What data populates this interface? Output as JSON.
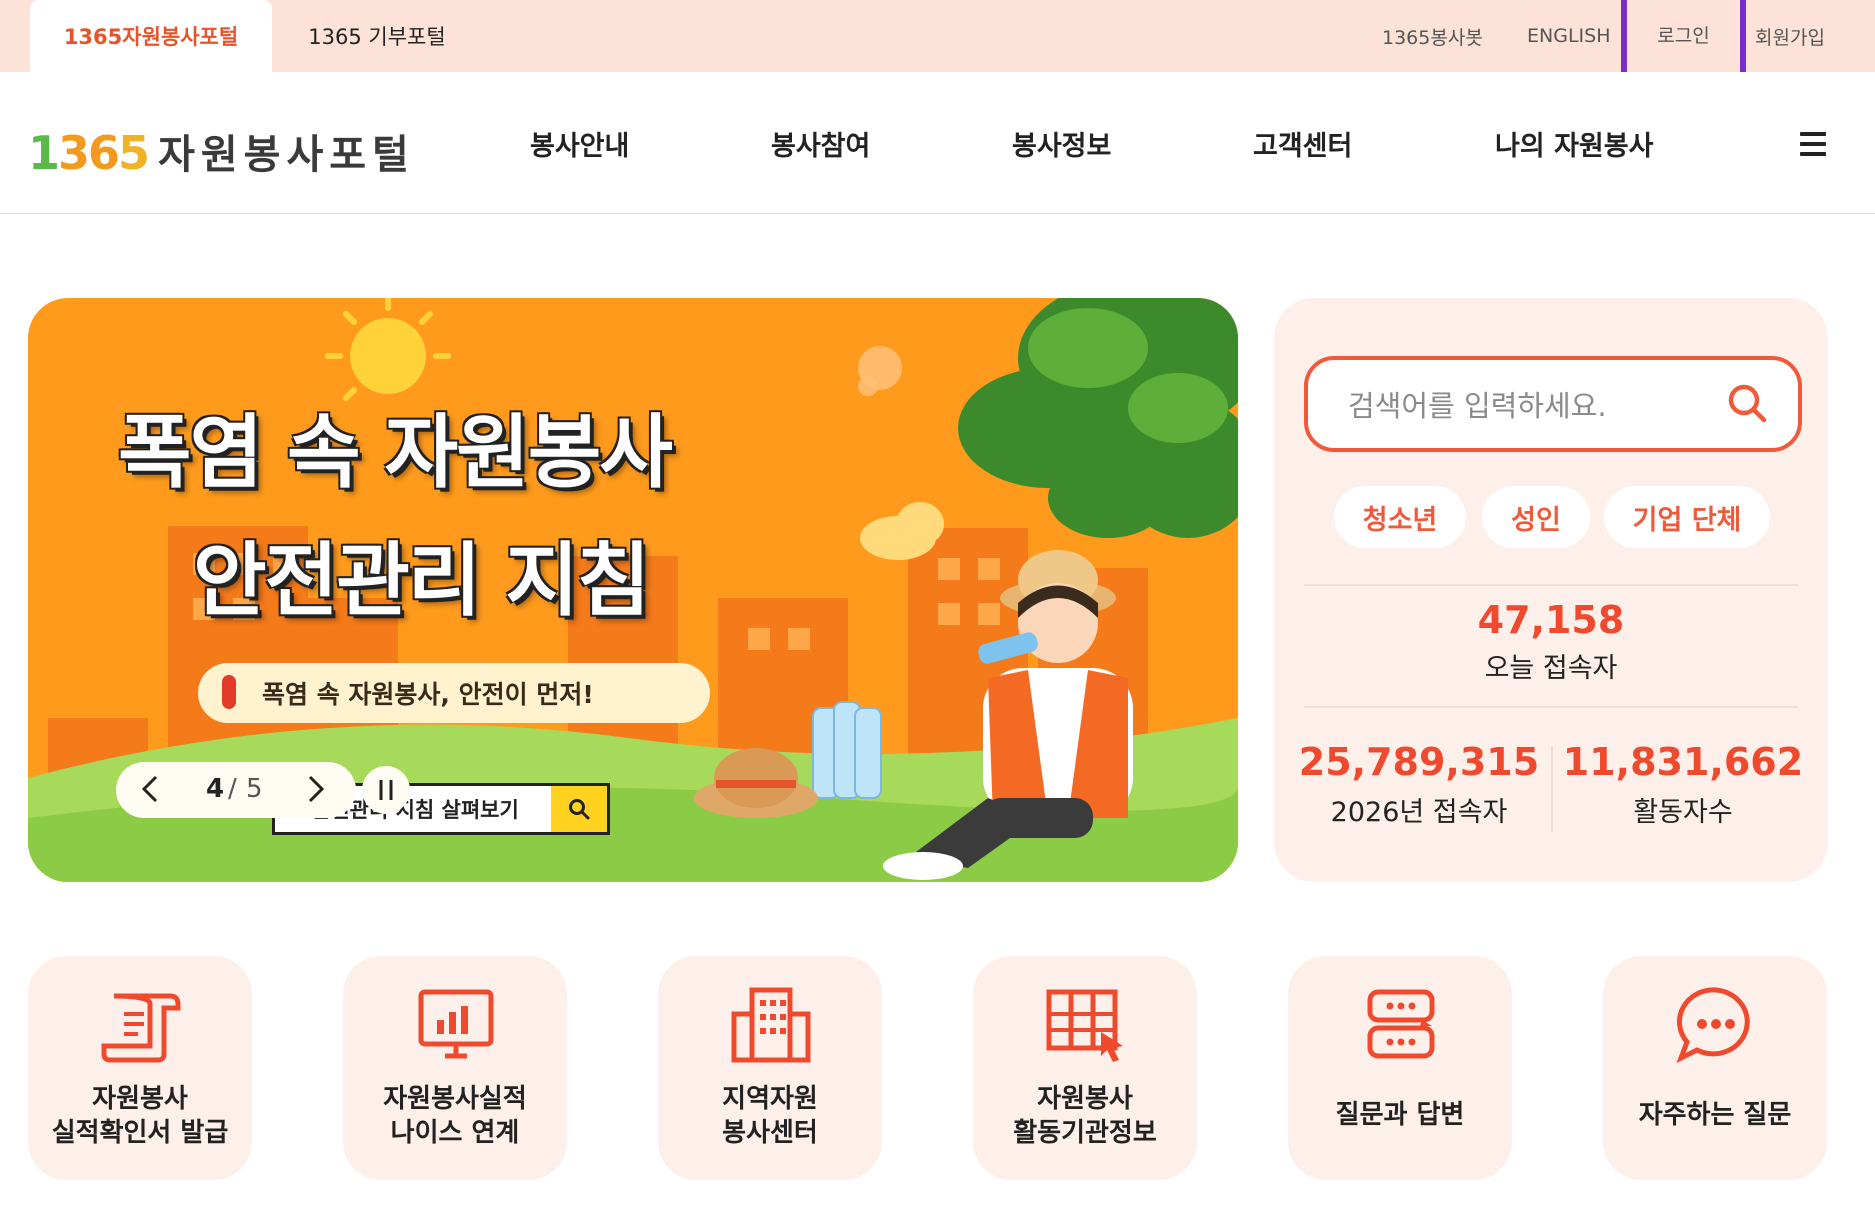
{
  "top_tabs": {
    "active": "1365자원봉사포털",
    "second": "1365 기부포털"
  },
  "util_links": {
    "bot": "1365봉사봇",
    "english": "ENGLISH",
    "login": "로그인",
    "join": "회원가입"
  },
  "logo": {
    "digits": [
      "1",
      "3",
      "6",
      "5"
    ],
    "text": "자원봉사포털"
  },
  "nav": [
    "봉사안내",
    "봉사참여",
    "봉사정보",
    "고객센터",
    "나의 자원봉사"
  ],
  "banner": {
    "title_line1": "폭염 속 자원봉사",
    "title_line2": "안전관리 지침",
    "subtitle": "폭염 속 자원봉사, 안전이 먼저!",
    "cta": "안전관리 지침 살펴보기",
    "slide_current": "4",
    "slide_total": "5"
  },
  "search": {
    "placeholder": "검색어를 입력하세요."
  },
  "audience_chips": [
    "청소년",
    "성인",
    "기업 단체"
  ],
  "stats": {
    "today_value": "47,158",
    "today_label": "오늘 접속자",
    "year_value": "25,789,315",
    "year_label": "2026년 접속자",
    "active_value": "11,831,662",
    "active_label": "활동자수"
  },
  "quick_menu": [
    {
      "line1": "자원봉사",
      "line2": "실적확인서 발급",
      "icon": "scroll-document-icon"
    },
    {
      "line1": "자원봉사실적",
      "line2": "나이스 연계",
      "icon": "monitor-chart-icon"
    },
    {
      "line1": "지역자원",
      "line2": "봉사센터",
      "icon": "building-icon"
    },
    {
      "line1": "자원봉사",
      "line2": "활동기관정보",
      "icon": "org-board-click-icon"
    },
    {
      "line1": "질문과 답변",
      "line2": "",
      "icon": "chat-bubbles-icon"
    },
    {
      "line1": "자주하는 질문",
      "line2": "",
      "icon": "speech-bubble-dots-icon"
    }
  ],
  "colors": {
    "accent": "#ef4a2e",
    "top_bar": "#fde3d7",
    "panel": "#fdf0ea",
    "banner_bg": "#ff9a1c",
    "focus_outline": "#7b2cc6"
  }
}
